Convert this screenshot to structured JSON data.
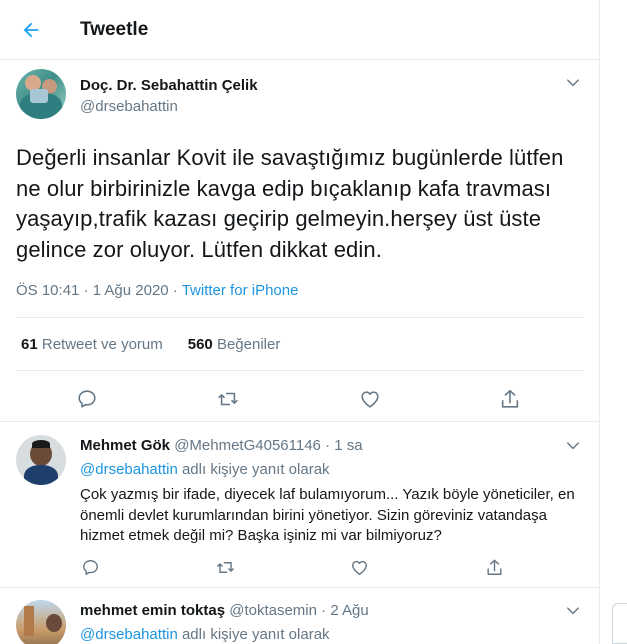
{
  "header": {
    "title": "Tweetle"
  },
  "main_tweet": {
    "author_name": "Doç. Dr. Sebahattin Çelik",
    "author_handle": "@drsebahattin",
    "text": "Değerli insanlar Kovit ile savaştığımız bugünlerde lütfen ne olur birbirinizle kavga edip bıçaklanıp kafa travması yaşayıp,trafik kazası geçirip gelmeyin.herşey üst üste gelince zor oluyor. Lütfen dikkat edin.",
    "time": "ÖS 10:41",
    "separator_1": " · ",
    "date": "1 Ağu 2020",
    "separator_2": " · ",
    "source": "Twitter for iPhone",
    "retweets_count": "61",
    "retweets_label": "Retweet ve yorum",
    "likes_count": "560",
    "likes_label": "Beğeniler"
  },
  "replies": [
    {
      "author_name": "Mehmet Gök",
      "author_handle": "@MehmetG40561146",
      "separator": " · ",
      "time": "1 sa",
      "replying_mention": "@drsebahattin",
      "replying_suffix": " adlı kişiye yanıt olarak",
      "text": "Çok yazmış  bir ifade, diyecek laf bulamıyorum... Yazık böyle yöneticiler, en önemli devlet kurumlarından birini yönetiyor. Sizin göreviniz vatandaşa hizmet etmek değil mi? Başka işiniz mi var bilmiyoruz?"
    },
    {
      "author_name": "mehmet emin toktaş",
      "author_handle": "@toktasemin",
      "separator": " · ",
      "time": "2 Ağu",
      "replying_mention": "@drsebahattin",
      "replying_suffix": " adlı kişiye yanıt olarak"
    }
  ],
  "icons": {
    "back": "arrow-left-icon",
    "more": "chevron-down-icon",
    "reply": "speech-bubble-icon",
    "retweet": "retweet-arrows-icon",
    "like": "heart-icon",
    "share": "share-upload-icon"
  },
  "colors": {
    "accent": "#1b95e0",
    "text": "#14171a",
    "muted": "#657786",
    "border": "#e6ecf0"
  }
}
